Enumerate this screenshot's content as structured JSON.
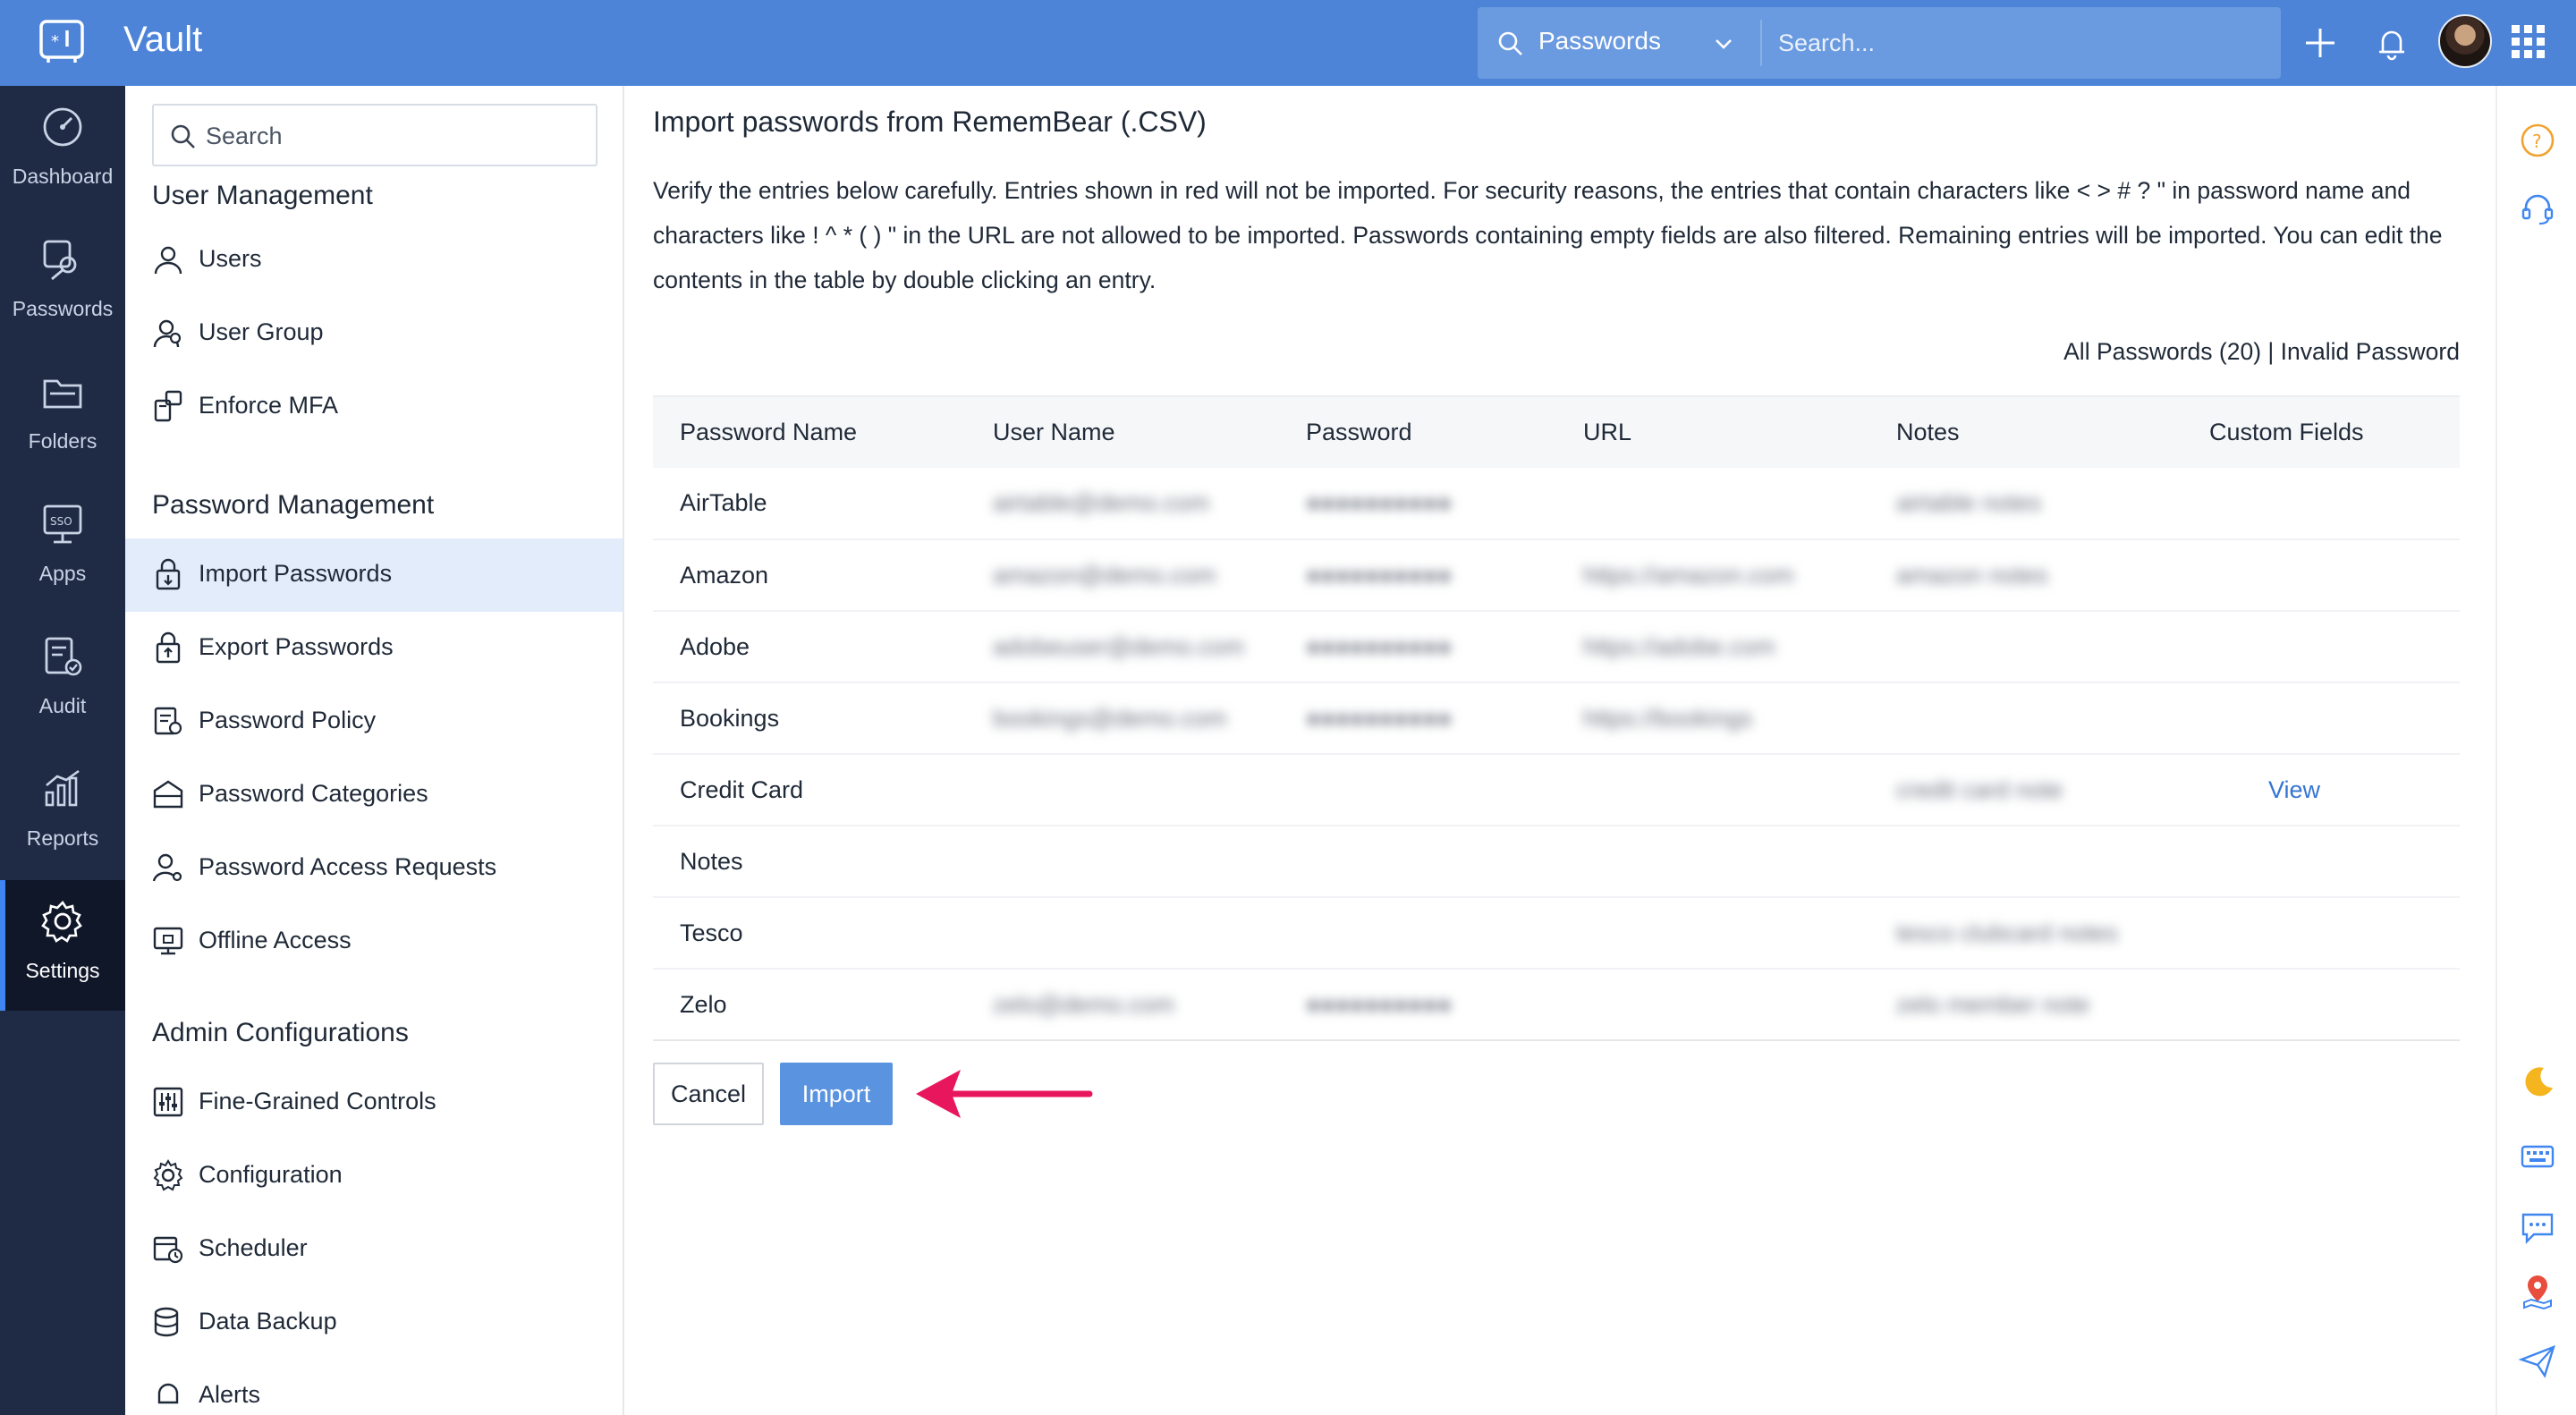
{
  "app": {
    "title": "Vault"
  },
  "topbar": {
    "search_scope": "Passwords",
    "search_placeholder": "Search..."
  },
  "rail": {
    "items": [
      {
        "label": "Dashboard",
        "icon": "dashboard-icon"
      },
      {
        "label": "Passwords",
        "icon": "key-icon"
      },
      {
        "label": "Folders",
        "icon": "folder-icon"
      },
      {
        "label": "Apps",
        "icon": "sso-icon"
      },
      {
        "label": "Audit",
        "icon": "audit-icon"
      },
      {
        "label": "Reports",
        "icon": "chart-icon"
      },
      {
        "label": "Settings",
        "icon": "gear-icon",
        "active": true
      }
    ]
  },
  "panel": {
    "search_placeholder": "Search",
    "sections": [
      {
        "title": "User Management",
        "items": [
          "Users",
          "User Group",
          "Enforce MFA"
        ]
      },
      {
        "title": "Password Management",
        "items": [
          "Import Passwords",
          "Export Passwords",
          "Password Policy",
          "Password Categories",
          "Password Access Requests",
          "Offline Access"
        ]
      },
      {
        "title": "Admin Configurations",
        "items": [
          "Fine-Grained Controls",
          "Configuration",
          "Scheduler",
          "Data Backup",
          "Alerts"
        ]
      }
    ],
    "active_item": "Import Passwords"
  },
  "main": {
    "title": "Import passwords from RememBear (.CSV)",
    "description": "Verify the entries below carefully. Entries shown in red will not be imported. For security reasons, the entries that contain characters like < > # ? \" in password name and characters like ! ^ * ( ) \" in the URL are not allowed to be imported. Passwords containing empty fields are also filtered. Remaining entries will be imported. You can edit the contents in the table by double clicking an entry.",
    "filter_all": "All Passwords (20)",
    "filter_separator": "|",
    "filter_invalid": "Invalid Password",
    "columns": [
      "Password Name",
      "User Name",
      "Password",
      "URL",
      "Notes",
      "Custom Fields"
    ],
    "rows": [
      {
        "name": "AirTable",
        "user": "airtable@demo.com",
        "password": "●●●●●●●●●●",
        "url": "",
        "notes": "airtable notes",
        "custom": ""
      },
      {
        "name": "Amazon",
        "user": "amazon@demo.com",
        "password": "●●●●●●●●●●",
        "url": "https://amazon.com",
        "notes": "amazon notes",
        "custom": ""
      },
      {
        "name": "Adobe",
        "user": "adobeuser@demo.com",
        "password": "●●●●●●●●●●",
        "url": "https://adobe.com",
        "notes": "",
        "custom": ""
      },
      {
        "name": "Bookings",
        "user": "bookings@demo.com",
        "password": "●●●●●●●●●●",
        "url": "https://bookings",
        "notes": "",
        "custom": ""
      },
      {
        "name": "Credit Card",
        "user": "",
        "password": "",
        "url": "",
        "notes": "credit card note",
        "custom": "View"
      },
      {
        "name": "Notes",
        "user": "",
        "password": "",
        "url": "",
        "notes": "",
        "custom": ""
      },
      {
        "name": "Tesco",
        "user": "",
        "password": "",
        "url": "",
        "notes": "tesco clubcard notes",
        "custom": ""
      },
      {
        "name": "Zelo",
        "user": "zelo@demo.com",
        "password": "●●●●●●●●●●",
        "url": "",
        "notes": "zelo member note",
        "custom": ""
      }
    ],
    "cancel_label": "Cancel",
    "import_label": "Import"
  },
  "util": {
    "icons": [
      "help-icon",
      "support-headset-icon",
      "moon-icon",
      "keyboard-icon",
      "chat-icon",
      "location-pin-icon",
      "send-icon"
    ]
  },
  "colors": {
    "topbar": "#4d84d8",
    "rail": "#1f2a44",
    "accent": "#5a93e0",
    "active_item_bg": "#e2ecfb",
    "annotation_arrow": "#e8175d",
    "link": "#3575d3"
  }
}
